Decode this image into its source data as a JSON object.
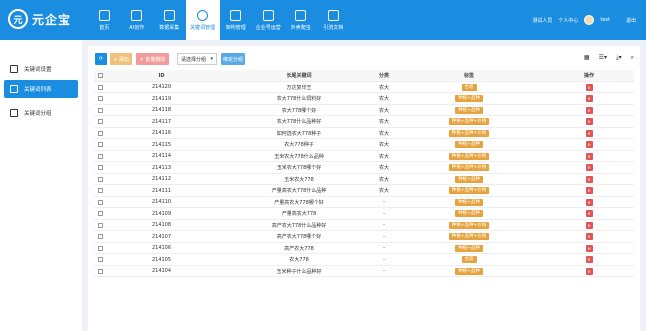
{
  "app": {
    "logo_mark": "元",
    "logo_text": "元企宝"
  },
  "nav": [
    {
      "label": "首页",
      "icon": "home-icon"
    },
    {
      "label": "AI创作",
      "icon": "layers-icon"
    },
    {
      "label": "数据采集",
      "icon": "video-icon"
    },
    {
      "label": "关键词管理",
      "icon": "target-icon"
    },
    {
      "label": "架构管理",
      "icon": "sitemap-icon"
    },
    {
      "label": "企业号运营",
      "icon": "monitor-icon"
    },
    {
      "label": "外卖爬虫",
      "icon": "card-icon"
    },
    {
      "label": "引流文档",
      "icon": "document-icon"
    }
  ],
  "header": {
    "user_name": "测试人员",
    "center_label": "个人中心",
    "admin": "test",
    "logout": "退出"
  },
  "sidebar": [
    {
      "label": "关键词设置",
      "icon": "gear-icon"
    },
    {
      "label": "关键词列表",
      "icon": "cloud-icon"
    },
    {
      "label": "关键词分组",
      "icon": "group-icon"
    }
  ],
  "toolbar": {
    "refresh_label": "⟳",
    "add_label": "+ 添加",
    "delete_label": "✕ 批量删除",
    "select_value": "请选择分组",
    "assign_label": "绑定分组",
    "right_icons": [
      "▦",
      "☰▾",
      "⤓▾",
      "⌕"
    ]
  },
  "table": {
    "headers": {
      "id": "ID",
      "keyword": "长尾关键词",
      "category": "分类",
      "tags": "标签",
      "ops": "操作"
    },
    "rows": [
      {
        "id": "214120",
        "keyword": "万达复印王",
        "category": "农大",
        "tag": "合适"
      },
      {
        "id": "214119",
        "keyword": "农大778什么饲料好",
        "category": "农大",
        "tag": "种植+品种"
      },
      {
        "id": "214118",
        "keyword": "农大778哪个好",
        "category": "农大",
        "tag": "种植+品种"
      },
      {
        "id": "214117",
        "keyword": "农大778什么品种好",
        "category": "农大",
        "tag": "种植+品种+价格"
      },
      {
        "id": "214116",
        "keyword": "如何选农大778种子",
        "category": "农大",
        "tag": "种植+品种+价格"
      },
      {
        "id": "214115",
        "keyword": "农大778种子",
        "category": "农大",
        "tag": "种植+品种"
      },
      {
        "id": "214114",
        "keyword": "玉米农大778什么品种",
        "category": "农大",
        "tag": "种植+品种+价格"
      },
      {
        "id": "214113",
        "keyword": "玉米农大778哪个好",
        "category": "农大",
        "tag": "种植+品种+价格"
      },
      {
        "id": "214112",
        "keyword": "玉米农大778",
        "category": "农大",
        "tag": "种植+品种"
      },
      {
        "id": "214111",
        "keyword": "产量高农大778什么品种",
        "category": "农大",
        "tag": "种植+品种+价格"
      },
      {
        "id": "214110",
        "keyword": "产量高农大778哪个好",
        "category": "-",
        "tag": "种植+品种"
      },
      {
        "id": "214109",
        "keyword": "产量高农大778",
        "category": "-",
        "tag": "种植+品种"
      },
      {
        "id": "214108",
        "keyword": "高产农大778什么品种好",
        "category": "-",
        "tag": "种植+品种+价格"
      },
      {
        "id": "214107",
        "keyword": "高产农大778哪个好",
        "category": "-",
        "tag": "种植+品种+价格"
      },
      {
        "id": "214106",
        "keyword": "高产农大778",
        "category": "-",
        "tag": "种植+品种"
      },
      {
        "id": "214105",
        "keyword": "农大778",
        "category": "-",
        "tag": "合适"
      },
      {
        "id": "214104",
        "keyword": "玉米种子什么品种好",
        "category": "-",
        "tag": "种植+品种"
      }
    ],
    "delete_icon": "✕"
  }
}
